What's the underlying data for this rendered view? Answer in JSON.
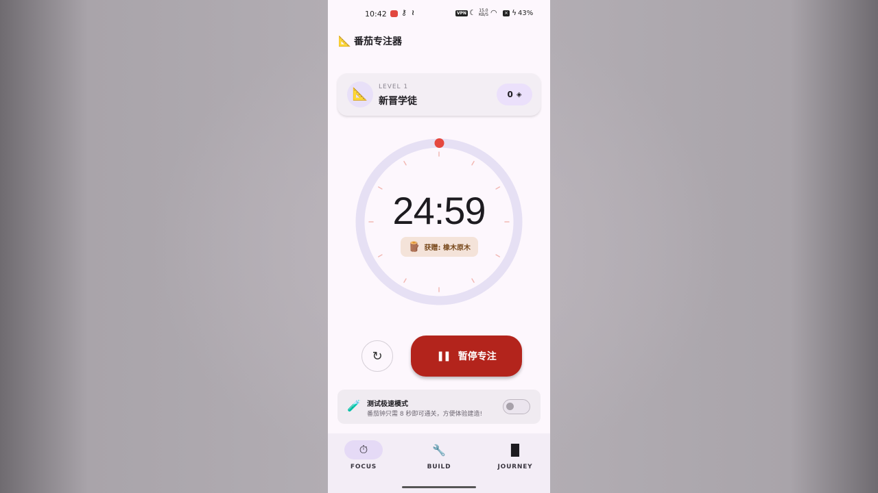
{
  "status_bar": {
    "time": "10:42",
    "vpn": "VPN",
    "speed_top": "15.0",
    "speed_bottom": "KB/S",
    "battery": "43%"
  },
  "header": {
    "icon": "triangle-ruler-icon",
    "title": "番茄专注器"
  },
  "level_card": {
    "level_label": "LEVEL 1",
    "rank_name": "新晋学徒",
    "count": "0",
    "count_icon": "layers-icon"
  },
  "timer": {
    "time": "24:59",
    "reward_icon": "wood-log-icon",
    "reward_text": "获赠: 橡木原木",
    "progress_fraction": 0.0007,
    "colors": {
      "ring": "#e6e0f4",
      "indicator": "#e5483f",
      "ticks": "#f2b8b3"
    }
  },
  "controls": {
    "reset_icon": "refresh-icon",
    "pause_label": "暂停专注",
    "pause_color": "#b3241c"
  },
  "test_mode": {
    "icon": "test-tube-icon",
    "title": "测试极速模式",
    "description": "番茄钟只需 8 秒即可通关，方便体验建造!",
    "enabled": false
  },
  "bottom_nav": {
    "items": [
      {
        "label": "FOCUS",
        "icon": "stopwatch-icon",
        "active": true
      },
      {
        "label": "BUILD",
        "icon": "wrench-icon",
        "active": false
      },
      {
        "label": "JOURNEY",
        "icon": "bar-chart-icon",
        "active": false
      }
    ]
  }
}
